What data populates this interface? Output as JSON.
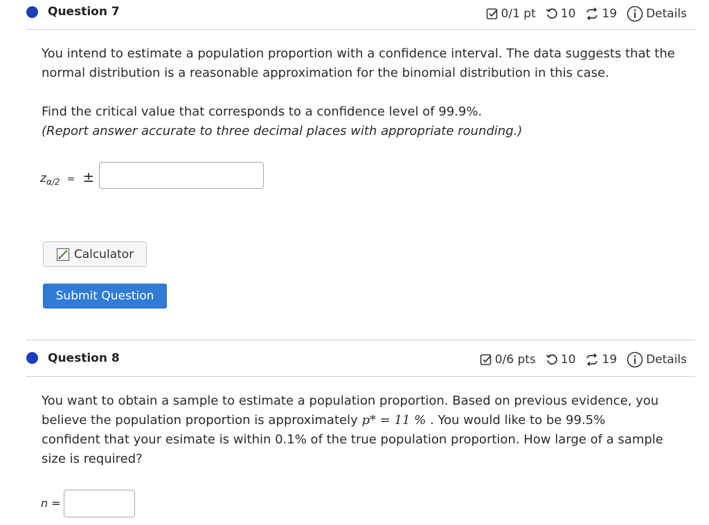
{
  "question7": {
    "title": "Question 7",
    "score": "0/1 pt",
    "retries": "10",
    "attempts": "19",
    "details": "Details",
    "intro": "You intend to estimate a population proportion with a confidence interval. The data suggests that the normal distribution is a reasonable approximation for the binomial distribution in this case.",
    "task": "Find the critical value that corresponds to a confidence level of 99.9%.",
    "instruction": "(Report answer accurate to three decimal places with appropriate rounding.)",
    "answer_label_z": "z",
    "answer_label_sub": "α/2",
    "answer_label_eq": "=",
    "plus_minus": "±",
    "answer_value": "",
    "calculator_label": "Calculator",
    "submit_label": "Submit Question"
  },
  "question8": {
    "title": "Question 8",
    "score": "0/6 pts",
    "retries": "10",
    "attempts": "19",
    "details": "Details",
    "line1": "You want to obtain a sample to estimate a population proportion. Based on previous evidence, you",
    "line2_pre": "believe the population proportion is approximately",
    "line2_math": "p* = 11 %",
    "line2_post": ". You would like to be 99.5%",
    "line3": "confident that your esimate is within 0.1% of the true population proportion. How large of a sample",
    "line4": "size is required?",
    "answer_label": "n =",
    "answer_value": ""
  },
  "colors": {
    "dot": "#1a3fb8",
    "submit": "#2f7bd6",
    "divider": "#cccccc"
  },
  "icons": [
    "score-check-icon",
    "retry-icon",
    "attempts-icon",
    "info-icon",
    "calculator-icon"
  ]
}
